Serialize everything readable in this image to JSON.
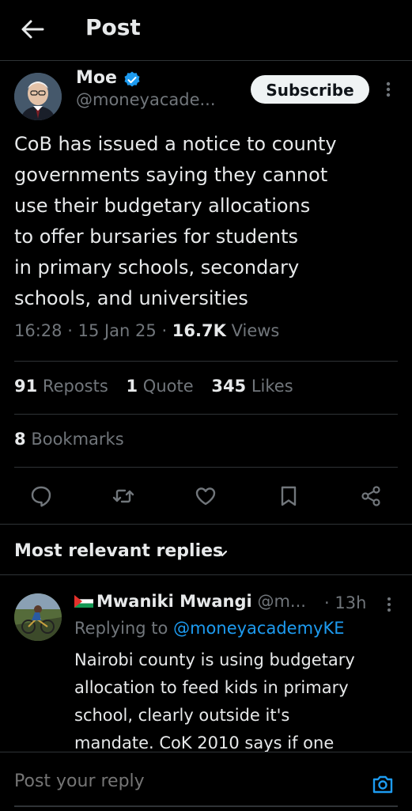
{
  "header": {
    "title": "Post"
  },
  "author": {
    "name": "Moe",
    "handle": "@moneyacade...",
    "subscribe_label": "Subscribe"
  },
  "post": {
    "text": "CoB has issued a notice to county\ngovernments saying they cannot\nuse their budgetary allocations\nto offer bursaries for students\nin primary schools, secondary\nschools, and universities",
    "time": "16:28",
    "date": "15 Jan 25",
    "views_count": "16.7K",
    "views_label": "Views"
  },
  "stats": {
    "reposts_count": "91",
    "reposts_label": "Reposts",
    "quotes_count": "1",
    "quotes_label": "Quote",
    "likes_count": "345",
    "likes_label": "Likes",
    "bookmarks_count": "8",
    "bookmarks_label": "Bookmarks"
  },
  "actions": [
    "reply-icon",
    "repost-icon",
    "like-icon",
    "bookmark-icon",
    "share-icon"
  ],
  "replies": {
    "filter_label": "Most relevant replies",
    "items": [
      {
        "name": "Mwaniki Mwangi",
        "handle": "@m...",
        "time": "· 13h",
        "replying_prefix": "Replying to",
        "replying_to": "@moneyacademyKE",
        "text": "Nairobi county is using budgetary\nallocation to feed kids in primary\nschool, clearly outside it's\nmandate. CoK 2010 says if one"
      }
    ]
  },
  "compose": {
    "placeholder": "Post your reply"
  },
  "colors": {
    "accent": "#1d9bf0",
    "background": "#000000",
    "muted": "#71767b",
    "text": "#e7e9ea"
  }
}
